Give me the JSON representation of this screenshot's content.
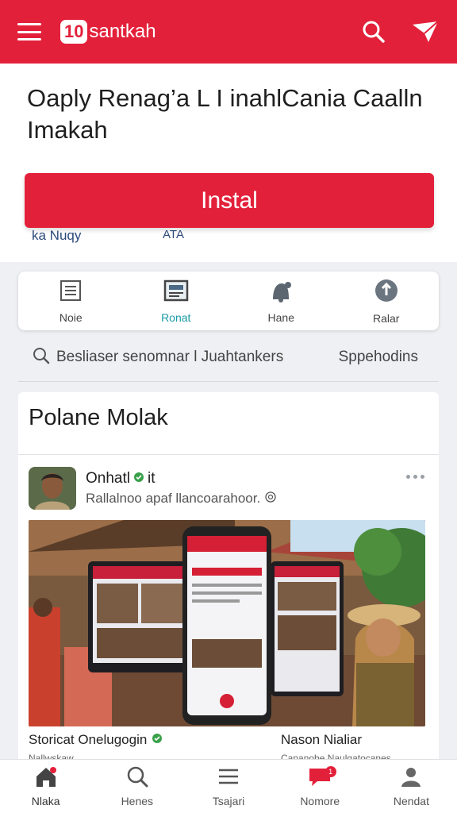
{
  "header": {
    "logo_badge": "10",
    "logo_text": "santkah",
    "menu_icon": "hamburger-menu-icon",
    "search_icon": "search-icon",
    "send_icon": "send-plane-icon",
    "background_color": "#e3203a"
  },
  "promo": {
    "title": "Oaply Renag’a L I inahlCania Caalln Imakah",
    "install_label": "Instal",
    "sub_left": "ka Nuqy",
    "sub_right": "ATA"
  },
  "quick_actions": [
    {
      "label": "Noie",
      "icon": "list-icon",
      "active": false
    },
    {
      "label": "Ronat",
      "icon": "news-icon",
      "active": true
    },
    {
      "label": "Hane",
      "icon": "bell-icon",
      "active": false
    },
    {
      "label": "Ralar",
      "icon": "info-icon",
      "active": false
    }
  ],
  "search": {
    "text": "Besliaser senomnar l Juahtankers",
    "right_link": "Sppehodins"
  },
  "card": {
    "title": "Polane Molak",
    "poster_name": "Onhatl",
    "poster_name_suffix": "it",
    "poster_sub": "Rallalnoo apaf llancoarahoor.",
    "caption_left": "Storicat Onelugogin",
    "caption_right": "Nason Nialiar",
    "caption_sub_left": "Nallwskaw",
    "caption_sub_right": "Cananobe Naulgatocanes"
  },
  "bottom_nav": [
    {
      "label": "Nlaka",
      "icon": "home-icon",
      "active": true
    },
    {
      "label": "Henes",
      "icon": "search-icon",
      "active": false
    },
    {
      "label": "Tsajari",
      "icon": "menu-lines-icon",
      "active": false
    },
    {
      "label": "Nomore",
      "icon": "chat-bubble-icon",
      "active": false,
      "badge": "1"
    },
    {
      "label": "Nendat",
      "icon": "profile-icon",
      "active": false
    }
  ]
}
